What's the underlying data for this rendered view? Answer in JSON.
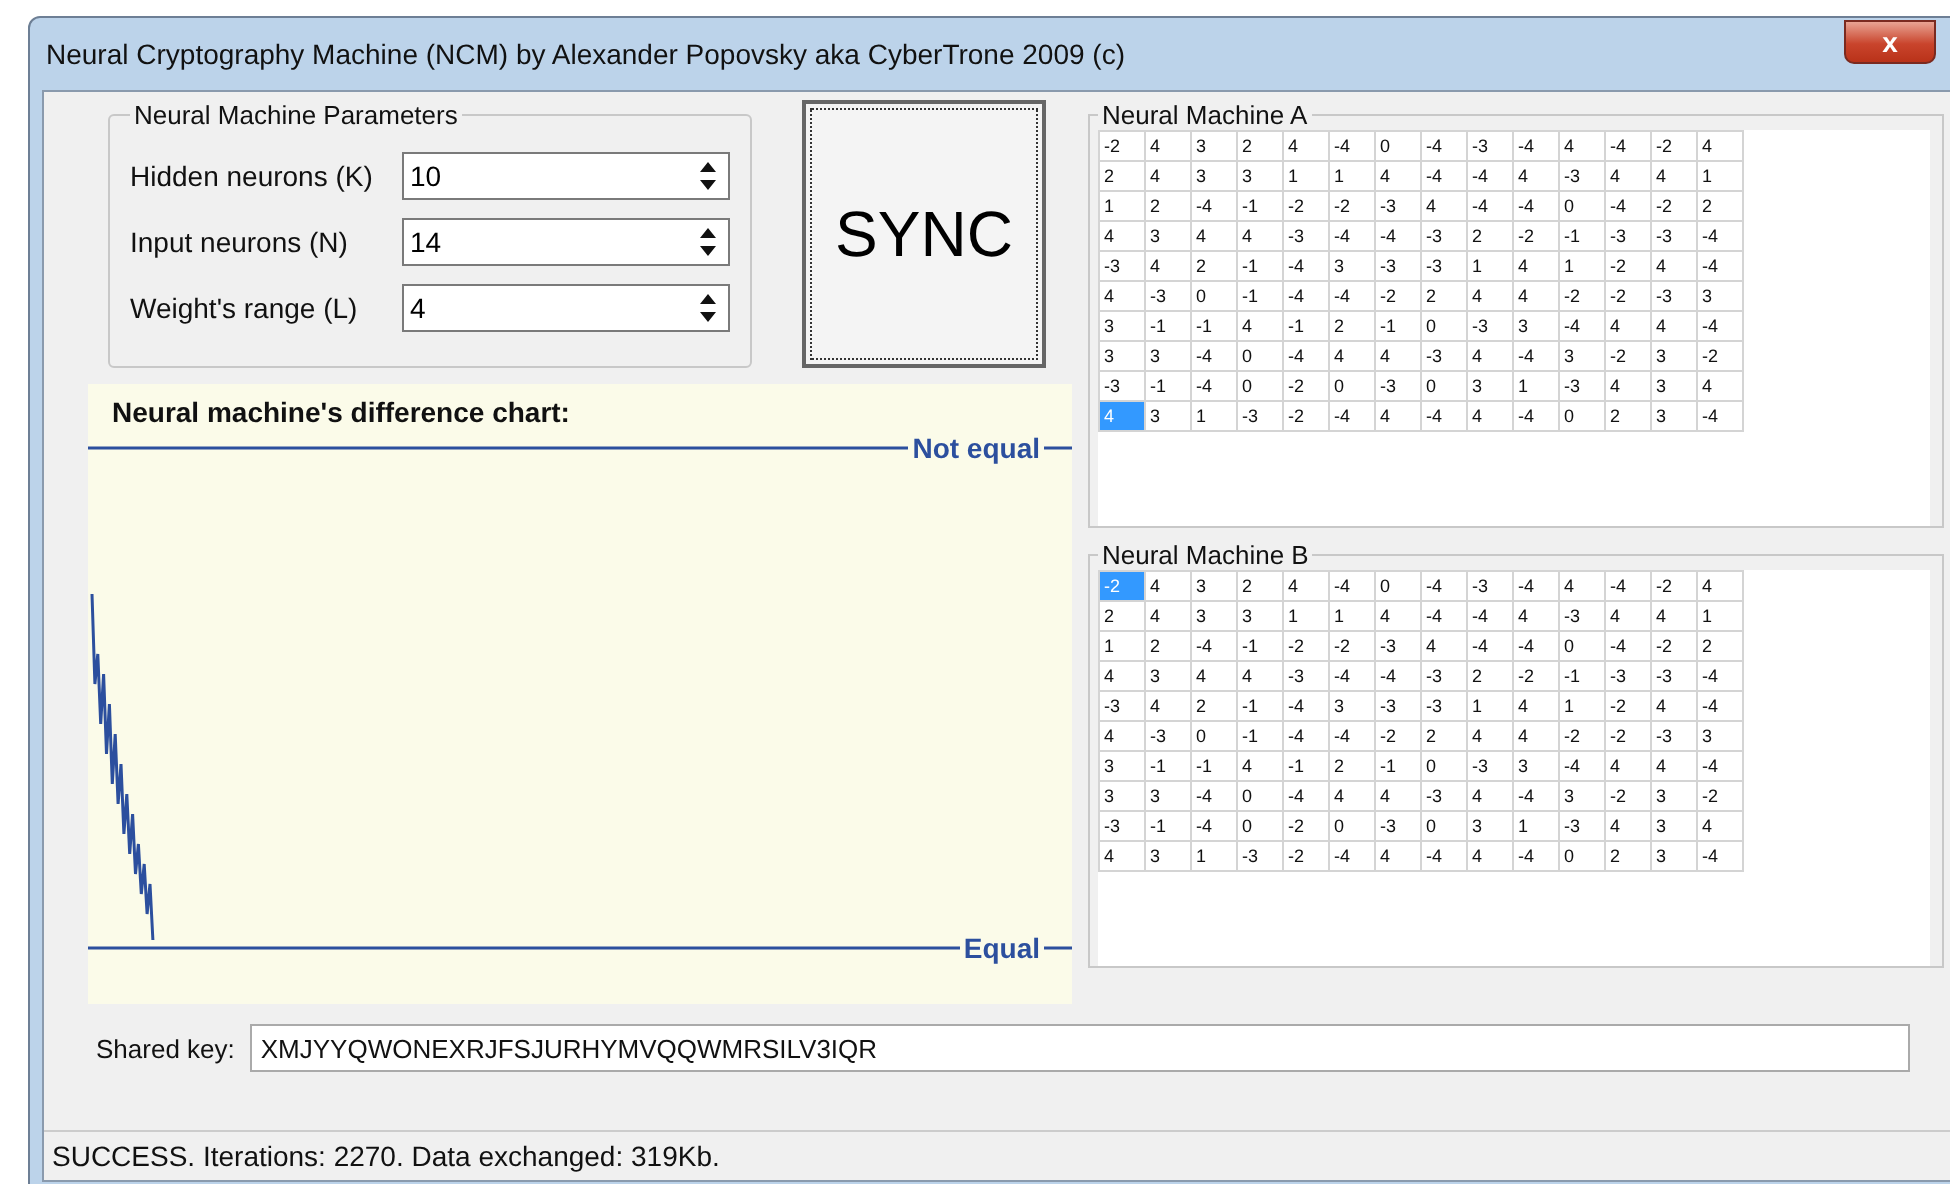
{
  "window": {
    "title": "Neural Cryptography Machine (NCM) by Alexander Popovsky aka CyberTrone 2009 (c)",
    "close": "x"
  },
  "parameters": {
    "title": "Neural Machine Parameters",
    "fields": [
      {
        "label": "Hidden neurons (K)",
        "value": "10"
      },
      {
        "label": "Input neurons (N)",
        "value": "14"
      },
      {
        "label": "Weight's range (L)",
        "value": "4"
      }
    ]
  },
  "sync_button": "SYNC",
  "chart": {
    "title": "Neural machine's difference chart:",
    "top_label": "Not equal",
    "bottom_label": "Equal"
  },
  "machines": [
    {
      "title": "Neural Machine A",
      "rows": [
        [
          {
            "t": "-2",
            "selected": false
          },
          {
            "t": "4",
            "selected": false
          },
          {
            "t": "3",
            "selected": false
          },
          {
            "t": "2",
            "selected": false
          },
          {
            "t": "4",
            "selected": false
          },
          {
            "t": "-4",
            "selected": false
          },
          {
            "t": "0",
            "selected": false
          },
          {
            "t": "-4",
            "selected": false
          },
          {
            "t": "-3",
            "selected": false
          },
          {
            "t": "-4",
            "selected": false
          },
          {
            "t": "4",
            "selected": false
          },
          {
            "t": "-4",
            "selected": false
          },
          {
            "t": "-2",
            "selected": false
          },
          {
            "t": "4",
            "selected": false
          }
        ],
        [
          {
            "t": "2",
            "selected": false
          },
          {
            "t": "4",
            "selected": false
          },
          {
            "t": "3",
            "selected": false
          },
          {
            "t": "3",
            "selected": false
          },
          {
            "t": "1",
            "selected": false
          },
          {
            "t": "1",
            "selected": false
          },
          {
            "t": "4",
            "selected": false
          },
          {
            "t": "-4",
            "selected": false
          },
          {
            "t": "-4",
            "selected": false
          },
          {
            "t": "4",
            "selected": false
          },
          {
            "t": "-3",
            "selected": false
          },
          {
            "t": "4",
            "selected": false
          },
          {
            "t": "4",
            "selected": false
          },
          {
            "t": "1",
            "selected": false
          }
        ],
        [
          {
            "t": "1",
            "selected": false
          },
          {
            "t": "2",
            "selected": false
          },
          {
            "t": "-4",
            "selected": false
          },
          {
            "t": "-1",
            "selected": false
          },
          {
            "t": "-2",
            "selected": false
          },
          {
            "t": "-2",
            "selected": false
          },
          {
            "t": "-3",
            "selected": false
          },
          {
            "t": "4",
            "selected": false
          },
          {
            "t": "-4",
            "selected": false
          },
          {
            "t": "-4",
            "selected": false
          },
          {
            "t": "0",
            "selected": false
          },
          {
            "t": "-4",
            "selected": false
          },
          {
            "t": "-2",
            "selected": false
          },
          {
            "t": "2",
            "selected": false
          }
        ],
        [
          {
            "t": "4",
            "selected": false
          },
          {
            "t": "3",
            "selected": false
          },
          {
            "t": "4",
            "selected": false
          },
          {
            "t": "4",
            "selected": false
          },
          {
            "t": "-3",
            "selected": false
          },
          {
            "t": "-4",
            "selected": false
          },
          {
            "t": "-4",
            "selected": false
          },
          {
            "t": "-3",
            "selected": false
          },
          {
            "t": "2",
            "selected": false
          },
          {
            "t": "-2",
            "selected": false
          },
          {
            "t": "-1",
            "selected": false
          },
          {
            "t": "-3",
            "selected": false
          },
          {
            "t": "-3",
            "selected": false
          },
          {
            "t": "-4",
            "selected": false
          }
        ],
        [
          {
            "t": "-3",
            "selected": false
          },
          {
            "t": "4",
            "selected": false
          },
          {
            "t": "2",
            "selected": false
          },
          {
            "t": "-1",
            "selected": false
          },
          {
            "t": "-4",
            "selected": false
          },
          {
            "t": "3",
            "selected": false
          },
          {
            "t": "-3",
            "selected": false
          },
          {
            "t": "-3",
            "selected": false
          },
          {
            "t": "1",
            "selected": false
          },
          {
            "t": "4",
            "selected": false
          },
          {
            "t": "1",
            "selected": false
          },
          {
            "t": "-2",
            "selected": false
          },
          {
            "t": "4",
            "selected": false
          },
          {
            "t": "-4",
            "selected": false
          }
        ],
        [
          {
            "t": "4",
            "selected": false
          },
          {
            "t": "-3",
            "selected": false
          },
          {
            "t": "0",
            "selected": false
          },
          {
            "t": "-1",
            "selected": false
          },
          {
            "t": "-4",
            "selected": false
          },
          {
            "t": "-4",
            "selected": false
          },
          {
            "t": "-2",
            "selected": false
          },
          {
            "t": "2",
            "selected": false
          },
          {
            "t": "4",
            "selected": false
          },
          {
            "t": "4",
            "selected": false
          },
          {
            "t": "-2",
            "selected": false
          },
          {
            "t": "-2",
            "selected": false
          },
          {
            "t": "-3",
            "selected": false
          },
          {
            "t": "3",
            "selected": false
          }
        ],
        [
          {
            "t": "3",
            "selected": false
          },
          {
            "t": "-1",
            "selected": false
          },
          {
            "t": "-1",
            "selected": false
          },
          {
            "t": "4",
            "selected": false
          },
          {
            "t": "-1",
            "selected": false
          },
          {
            "t": "2",
            "selected": false
          },
          {
            "t": "-1",
            "selected": false
          },
          {
            "t": "0",
            "selected": false
          },
          {
            "t": "-3",
            "selected": false
          },
          {
            "t": "3",
            "selected": false
          },
          {
            "t": "-4",
            "selected": false
          },
          {
            "t": "4",
            "selected": false
          },
          {
            "t": "4",
            "selected": false
          },
          {
            "t": "-4",
            "selected": false
          }
        ],
        [
          {
            "t": "3",
            "selected": false
          },
          {
            "t": "3",
            "selected": false
          },
          {
            "t": "-4",
            "selected": false
          },
          {
            "t": "0",
            "selected": false
          },
          {
            "t": "-4",
            "selected": false
          },
          {
            "t": "4",
            "selected": false
          },
          {
            "t": "4",
            "selected": false
          },
          {
            "t": "-3",
            "selected": false
          },
          {
            "t": "4",
            "selected": false
          },
          {
            "t": "-4",
            "selected": false
          },
          {
            "t": "3",
            "selected": false
          },
          {
            "t": "-2",
            "selected": false
          },
          {
            "t": "3",
            "selected": false
          },
          {
            "t": "-2",
            "selected": false
          }
        ],
        [
          {
            "t": "-3",
            "selected": false
          },
          {
            "t": "-1",
            "selected": false
          },
          {
            "t": "-4",
            "selected": false
          },
          {
            "t": "0",
            "selected": false
          },
          {
            "t": "-2",
            "selected": false
          },
          {
            "t": "0",
            "selected": false
          },
          {
            "t": "-3",
            "selected": false
          },
          {
            "t": "0",
            "selected": false
          },
          {
            "t": "3",
            "selected": false
          },
          {
            "t": "1",
            "selected": false
          },
          {
            "t": "-3",
            "selected": false
          },
          {
            "t": "4",
            "selected": false
          },
          {
            "t": "3",
            "selected": false
          },
          {
            "t": "4",
            "selected": false
          }
        ],
        [
          {
            "t": "4",
            "selected": true
          },
          {
            "t": "3",
            "selected": false
          },
          {
            "t": "1",
            "selected": false
          },
          {
            "t": "-3",
            "selected": false
          },
          {
            "t": "-2",
            "selected": false
          },
          {
            "t": "-4",
            "selected": false
          },
          {
            "t": "4",
            "selected": false
          },
          {
            "t": "-4",
            "selected": false
          },
          {
            "t": "4",
            "selected": false
          },
          {
            "t": "-4",
            "selected": false
          },
          {
            "t": "0",
            "selected": false
          },
          {
            "t": "2",
            "selected": false
          },
          {
            "t": "3",
            "selected": false
          },
          {
            "t": "-4",
            "selected": false
          }
        ]
      ]
    },
    {
      "title": "Neural Machine B",
      "rows": [
        [
          {
            "t": "-2",
            "selected": true
          },
          {
            "t": "4",
            "selected": false
          },
          {
            "t": "3",
            "selected": false
          },
          {
            "t": "2",
            "selected": false
          },
          {
            "t": "4",
            "selected": false
          },
          {
            "t": "-4",
            "selected": false
          },
          {
            "t": "0",
            "selected": false
          },
          {
            "t": "-4",
            "selected": false
          },
          {
            "t": "-3",
            "selected": false
          },
          {
            "t": "-4",
            "selected": false
          },
          {
            "t": "4",
            "selected": false
          },
          {
            "t": "-4",
            "selected": false
          },
          {
            "t": "-2",
            "selected": false
          },
          {
            "t": "4",
            "selected": false
          }
        ],
        [
          {
            "t": "2",
            "selected": false
          },
          {
            "t": "4",
            "selected": false
          },
          {
            "t": "3",
            "selected": false
          },
          {
            "t": "3",
            "selected": false
          },
          {
            "t": "1",
            "selected": false
          },
          {
            "t": "1",
            "selected": false
          },
          {
            "t": "4",
            "selected": false
          },
          {
            "t": "-4",
            "selected": false
          },
          {
            "t": "-4",
            "selected": false
          },
          {
            "t": "4",
            "selected": false
          },
          {
            "t": "-3",
            "selected": false
          },
          {
            "t": "4",
            "selected": false
          },
          {
            "t": "4",
            "selected": false
          },
          {
            "t": "1",
            "selected": false
          }
        ],
        [
          {
            "t": "1",
            "selected": false
          },
          {
            "t": "2",
            "selected": false
          },
          {
            "t": "-4",
            "selected": false
          },
          {
            "t": "-1",
            "selected": false
          },
          {
            "t": "-2",
            "selected": false
          },
          {
            "t": "-2",
            "selected": false
          },
          {
            "t": "-3",
            "selected": false
          },
          {
            "t": "4",
            "selected": false
          },
          {
            "t": "-4",
            "selected": false
          },
          {
            "t": "-4",
            "selected": false
          },
          {
            "t": "0",
            "selected": false
          },
          {
            "t": "-4",
            "selected": false
          },
          {
            "t": "-2",
            "selected": false
          },
          {
            "t": "2",
            "selected": false
          }
        ],
        [
          {
            "t": "4",
            "selected": false
          },
          {
            "t": "3",
            "selected": false
          },
          {
            "t": "4",
            "selected": false
          },
          {
            "t": "4",
            "selected": false
          },
          {
            "t": "-3",
            "selected": false
          },
          {
            "t": "-4",
            "selected": false
          },
          {
            "t": "-4",
            "selected": false
          },
          {
            "t": "-3",
            "selected": false
          },
          {
            "t": "2",
            "selected": false
          },
          {
            "t": "-2",
            "selected": false
          },
          {
            "t": "-1",
            "selected": false
          },
          {
            "t": "-3",
            "selected": false
          },
          {
            "t": "-3",
            "selected": false
          },
          {
            "t": "-4",
            "selected": false
          }
        ],
        [
          {
            "t": "-3",
            "selected": false
          },
          {
            "t": "4",
            "selected": false
          },
          {
            "t": "2",
            "selected": false
          },
          {
            "t": "-1",
            "selected": false
          },
          {
            "t": "-4",
            "selected": false
          },
          {
            "t": "3",
            "selected": false
          },
          {
            "t": "-3",
            "selected": false
          },
          {
            "t": "-3",
            "selected": false
          },
          {
            "t": "1",
            "selected": false
          },
          {
            "t": "4",
            "selected": false
          },
          {
            "t": "1",
            "selected": false
          },
          {
            "t": "-2",
            "selected": false
          },
          {
            "t": "4",
            "selected": false
          },
          {
            "t": "-4",
            "selected": false
          }
        ],
        [
          {
            "t": "4",
            "selected": false
          },
          {
            "t": "-3",
            "selected": false
          },
          {
            "t": "0",
            "selected": false
          },
          {
            "t": "-1",
            "selected": false
          },
          {
            "t": "-4",
            "selected": false
          },
          {
            "t": "-4",
            "selected": false
          },
          {
            "t": "-2",
            "selected": false
          },
          {
            "t": "2",
            "selected": false
          },
          {
            "t": "4",
            "selected": false
          },
          {
            "t": "4",
            "selected": false
          },
          {
            "t": "-2",
            "selected": false
          },
          {
            "t": "-2",
            "selected": false
          },
          {
            "t": "-3",
            "selected": false
          },
          {
            "t": "3",
            "selected": false
          }
        ],
        [
          {
            "t": "3",
            "selected": false
          },
          {
            "t": "-1",
            "selected": false
          },
          {
            "t": "-1",
            "selected": false
          },
          {
            "t": "4",
            "selected": false
          },
          {
            "t": "-1",
            "selected": false
          },
          {
            "t": "2",
            "selected": false
          },
          {
            "t": "-1",
            "selected": false
          },
          {
            "t": "0",
            "selected": false
          },
          {
            "t": "-3",
            "selected": false
          },
          {
            "t": "3",
            "selected": false
          },
          {
            "t": "-4",
            "selected": false
          },
          {
            "t": "4",
            "selected": false
          },
          {
            "t": "4",
            "selected": false
          },
          {
            "t": "-4",
            "selected": false
          }
        ],
        [
          {
            "t": "3",
            "selected": false
          },
          {
            "t": "3",
            "selected": false
          },
          {
            "t": "-4",
            "selected": false
          },
          {
            "t": "0",
            "selected": false
          },
          {
            "t": "-4",
            "selected": false
          },
          {
            "t": "4",
            "selected": false
          },
          {
            "t": "4",
            "selected": false
          },
          {
            "t": "-3",
            "selected": false
          },
          {
            "t": "4",
            "selected": false
          },
          {
            "t": "-4",
            "selected": false
          },
          {
            "t": "3",
            "selected": false
          },
          {
            "t": "-2",
            "selected": false
          },
          {
            "t": "3",
            "selected": false
          },
          {
            "t": "-2",
            "selected": false
          }
        ],
        [
          {
            "t": "-3",
            "selected": false
          },
          {
            "t": "-1",
            "selected": false
          },
          {
            "t": "-4",
            "selected": false
          },
          {
            "t": "0",
            "selected": false
          },
          {
            "t": "-2",
            "selected": false
          },
          {
            "t": "0",
            "selected": false
          },
          {
            "t": "-3",
            "selected": false
          },
          {
            "t": "0",
            "selected": false
          },
          {
            "t": "3",
            "selected": false
          },
          {
            "t": "1",
            "selected": false
          },
          {
            "t": "-3",
            "selected": false
          },
          {
            "t": "4",
            "selected": false
          },
          {
            "t": "3",
            "selected": false
          },
          {
            "t": "4",
            "selected": false
          }
        ],
        [
          {
            "t": "4",
            "selected": false
          },
          {
            "t": "3",
            "selected": false
          },
          {
            "t": "1",
            "selected": false
          },
          {
            "t": "-3",
            "selected": false
          },
          {
            "t": "-2",
            "selected": false
          },
          {
            "t": "-4",
            "selected": false
          },
          {
            "t": "4",
            "selected": false
          },
          {
            "t": "-4",
            "selected": false
          },
          {
            "t": "4",
            "selected": false
          },
          {
            "t": "-4",
            "selected": false
          },
          {
            "t": "0",
            "selected": false
          },
          {
            "t": "2",
            "selected": false
          },
          {
            "t": "3",
            "selected": false
          },
          {
            "t": "-4",
            "selected": false
          }
        ]
      ]
    }
  ],
  "shared_key": {
    "label": "Shared key:",
    "value": "XMJYYQWONEXRJFSJURHYMVQQWMRSILV3IQR"
  },
  "status_bar": "SUCCESS. Iterations: 2270. Data exchanged: 319Kb."
}
